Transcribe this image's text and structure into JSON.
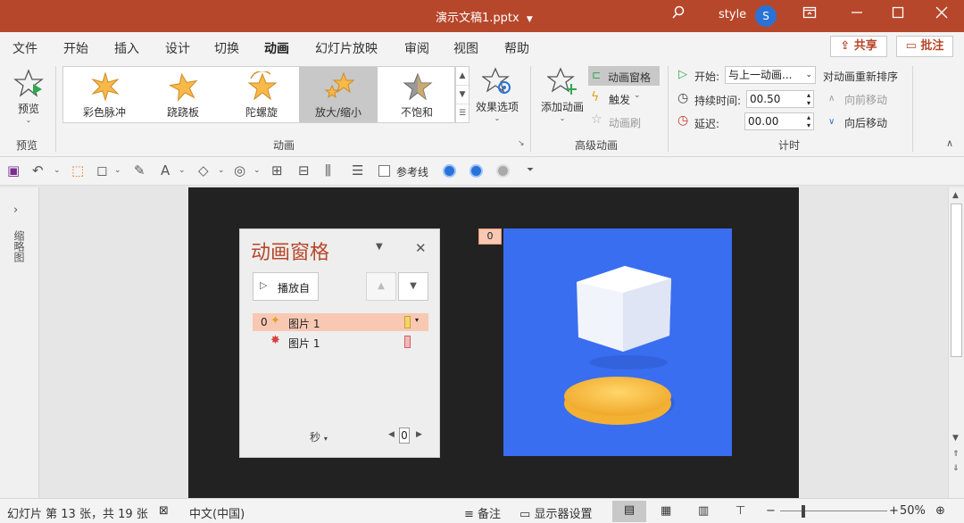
{
  "titlebar": {
    "doc_title": "演示文稿1.pptx",
    "user_name": "style",
    "avatar_letter": "S",
    "bg_color": "#b7472a"
  },
  "menu": {
    "tabs": [
      "文件",
      "开始",
      "插入",
      "设计",
      "切换",
      "动画",
      "幻灯片放映",
      "审阅",
      "视图",
      "帮助"
    ],
    "active_index": 5,
    "share_label": "共享",
    "comment_label": "批注"
  },
  "ribbon": {
    "preview_label": "预览",
    "preview_group": "预览",
    "gallery": [
      {
        "label": "彩色脉冲",
        "icon": "color-pulse-icon"
      },
      {
        "label": "跷跷板",
        "icon": "teeter-icon"
      },
      {
        "label": "陀螺旋",
        "icon": "spin-icon"
      },
      {
        "label": "放大/缩小",
        "icon": "grow-shrink-icon"
      },
      {
        "label": "不饱和",
        "icon": "desaturate-icon"
      }
    ],
    "selected_index": 3,
    "effect_options_label": "效果选项",
    "animation_group": "动画",
    "add_animation_label": "添加动画",
    "anim_pane_label": "动画窗格",
    "trigger_label": "触发",
    "anim_painter_label": "动画刷",
    "advanced_group": "高级动画",
    "start_label": "开始:",
    "start_value": "与上一动画...",
    "duration_label": "持续时间:",
    "duration_value": "00.50",
    "delay_label": "延迟:",
    "delay_value": "00.00",
    "timing_group": "计时",
    "reorder_label": "对动画重新排序",
    "move_earlier_label": "向前移动",
    "move_later_label": "向后移动"
  },
  "qat": {
    "ref_line_label": "参考线"
  },
  "thumbnail_pane": {
    "label": "缩略图"
  },
  "animation_pane": {
    "title": "动画窗格",
    "play_label": "播放自",
    "items": [
      {
        "index": "0",
        "label": "图片 1",
        "highlighted": true,
        "bar_color": "#f3d46a"
      },
      {
        "index": "",
        "label": "图片 1",
        "highlighted": false,
        "bar_color": "#f2b8b8"
      }
    ],
    "seconds_label": "秒",
    "timeline_value": "0"
  },
  "slide": {
    "anim_tag": "0",
    "image_bg": "#3a6ef0"
  },
  "status": {
    "slide_info": "幻灯片 第 13 张，共 19 张",
    "language": "中文(中国)",
    "notes_label": "备注",
    "display_settings_label": "显示器设置",
    "zoom": "50%"
  }
}
